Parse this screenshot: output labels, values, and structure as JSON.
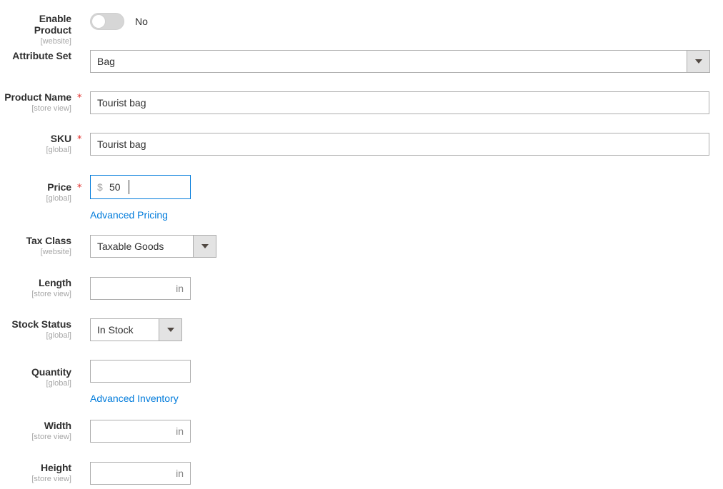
{
  "form": {
    "fields": [
      {
        "key": "enable_product",
        "label": "Enable Product",
        "scope": "[website]",
        "type": "toggle",
        "value": "No",
        "required": false
      },
      {
        "key": "attribute_set",
        "label": "Attribute Set",
        "scope": "",
        "type": "select",
        "value": "Bag",
        "required": false
      },
      {
        "key": "product_name",
        "label": "Product Name",
        "scope": "[store view]",
        "type": "text",
        "value": "Tourist bag",
        "placeholder": "",
        "required": true
      },
      {
        "key": "sku",
        "label": "SKU",
        "scope": "[global]",
        "type": "text",
        "value": "Tourist bag",
        "placeholder": "",
        "required": true
      },
      {
        "key": "price",
        "label": "Price",
        "scope": "[global]",
        "type": "price",
        "value": "50",
        "currency": "$",
        "required": true,
        "focused": true,
        "link": "Advanced Pricing"
      },
      {
        "key": "tax_class",
        "label": "Tax Class",
        "scope": "[website]",
        "type": "select",
        "value": "Taxable Goods",
        "required": false
      },
      {
        "key": "length",
        "label": "Length",
        "scope": "[store view]",
        "type": "unit",
        "value": "",
        "placeholder": "",
        "unit": "in",
        "required": false
      },
      {
        "key": "stock_status",
        "label": "Stock Status",
        "scope": "[global]",
        "type": "select",
        "value": "In Stock",
        "required": false
      },
      {
        "key": "quantity",
        "label": "Quantity",
        "scope": "[global]",
        "type": "text",
        "value": "",
        "placeholder": "",
        "required": false,
        "link": "Advanced Inventory"
      },
      {
        "key": "width",
        "label": "Width",
        "scope": "[store view]",
        "type": "unit",
        "value": "",
        "placeholder": "",
        "unit": "in",
        "required": false
      },
      {
        "key": "height",
        "label": "Height",
        "scope": "[store view]",
        "type": "unit",
        "value": "",
        "placeholder": "",
        "unit": "in",
        "required": false
      }
    ],
    "icons": {
      "dropdown": "chevron-down-icon",
      "required_marker": "*"
    },
    "colors": {
      "link": "#007bdb",
      "focus_border": "#007bdb",
      "required_star": "#e02b27",
      "scope_text": "#a6a6a6",
      "input_border": "#adadad"
    }
  }
}
